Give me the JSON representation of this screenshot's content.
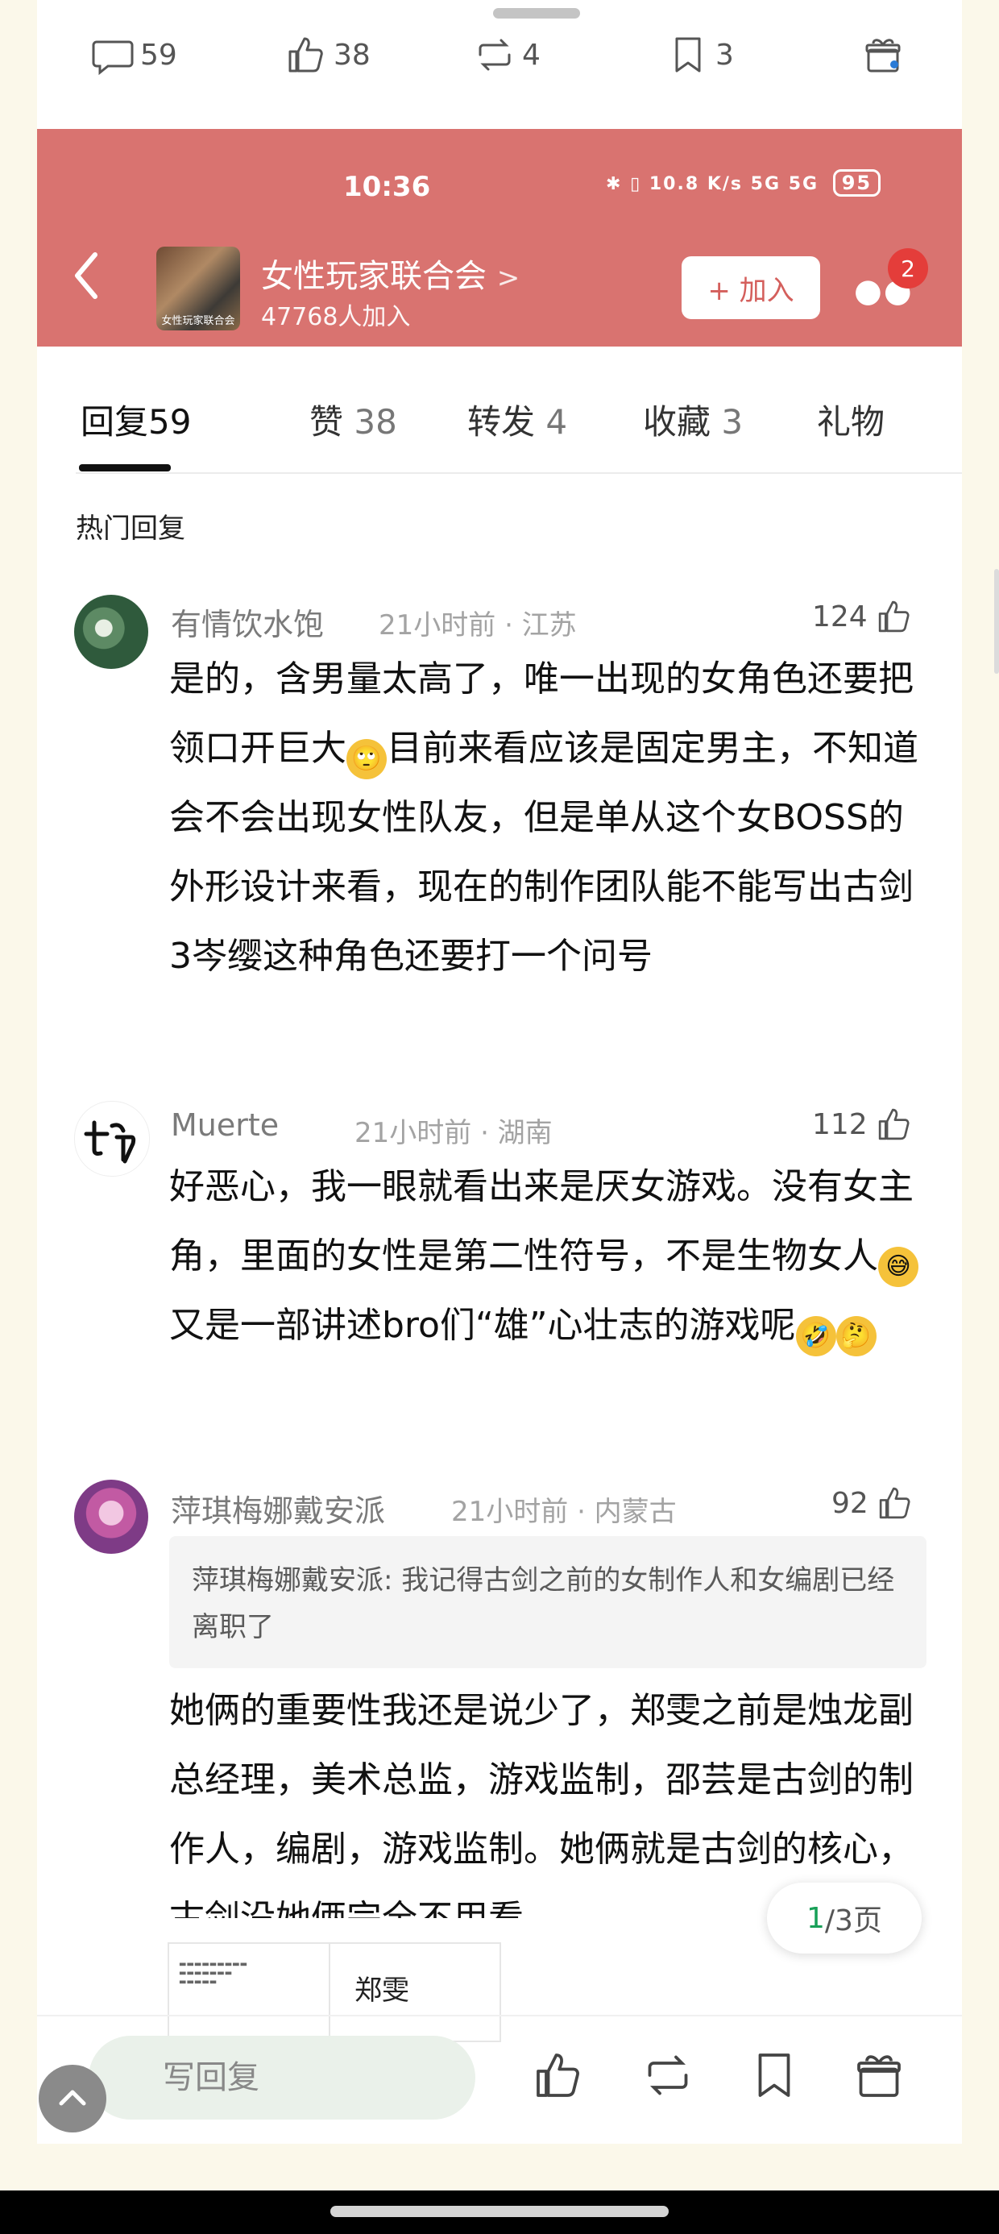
{
  "top_actions": {
    "comments": "59",
    "likes": "38",
    "reposts": "4",
    "favorites": "3"
  },
  "status_bar": {
    "time": "10:36",
    "net_speed": "10.8 K/s",
    "signal": "5G  5G",
    "battery": "95"
  },
  "group": {
    "name": "女性玩家联合会",
    "name_chevron": ">",
    "avatar_caption": "女性玩家联合会",
    "members": "47768人加入",
    "join_label": "+ 加入",
    "more_badge": "2"
  },
  "tabs": [
    {
      "label": "回复",
      "count": "59"
    },
    {
      "label": "赞",
      "count": "38"
    },
    {
      "label": "转发",
      "count": "4"
    },
    {
      "label": "收藏",
      "count": "3"
    },
    {
      "label": "礼物",
      "count": ""
    }
  ],
  "section_title": "热门回复",
  "comments": [
    {
      "name": "有情饮水饱",
      "meta": "21小时前 · 江苏",
      "likes": "124",
      "text_a": "是的，含男量太高了，唯一出现的女角色还要把领口开巨大",
      "emoji_a": "🙄",
      "text_b": "目前来看应该是固定男主，不知道会不会出现女性队友，但是单从这个女BOSS的外形设计来看，现在的制作团队能不能写出古剑3岑缨这种角色还要打一个问号"
    },
    {
      "name": "Muerte",
      "meta": "21小时前 · 湖南",
      "likes": "112",
      "text_a": "好恶心，我一眼就看出来是厌女游戏。没有女主角，里面的女性是第二性符号，不是生物女人",
      "emoji_a": "😅",
      "text_b": "又是一部讲述bro们“雄”心壮志的游戏呢",
      "emoji_b": "🤣",
      "emoji_c": "🤔"
    },
    {
      "name": "萍琪梅娜戴安派",
      "meta": "21小时前 · 内蒙古",
      "likes": "92",
      "quote": "萍琪梅娜戴安派: 我记得古剑之前的女制作人和女编剧已经离职了",
      "text_a": "她俩的重要性我还是说少了，郑雯之前是烛龙副总经理，美术总监，游戏监制，邵芸是古剑的制作人，编剧，游戏监制。她俩就是古剑的核心，古剑没她俩完全不用看",
      "image_name": "郑雯"
    }
  ],
  "pager": {
    "current": "1",
    "total_label": "/3页"
  },
  "bottom_bar": {
    "reply_placeholder": "写回复"
  },
  "colors": {
    "header_red": "#d97370",
    "page_bg": "#fbf8ea",
    "badge_red": "#e43d3a",
    "pager_green": "#18a058"
  }
}
